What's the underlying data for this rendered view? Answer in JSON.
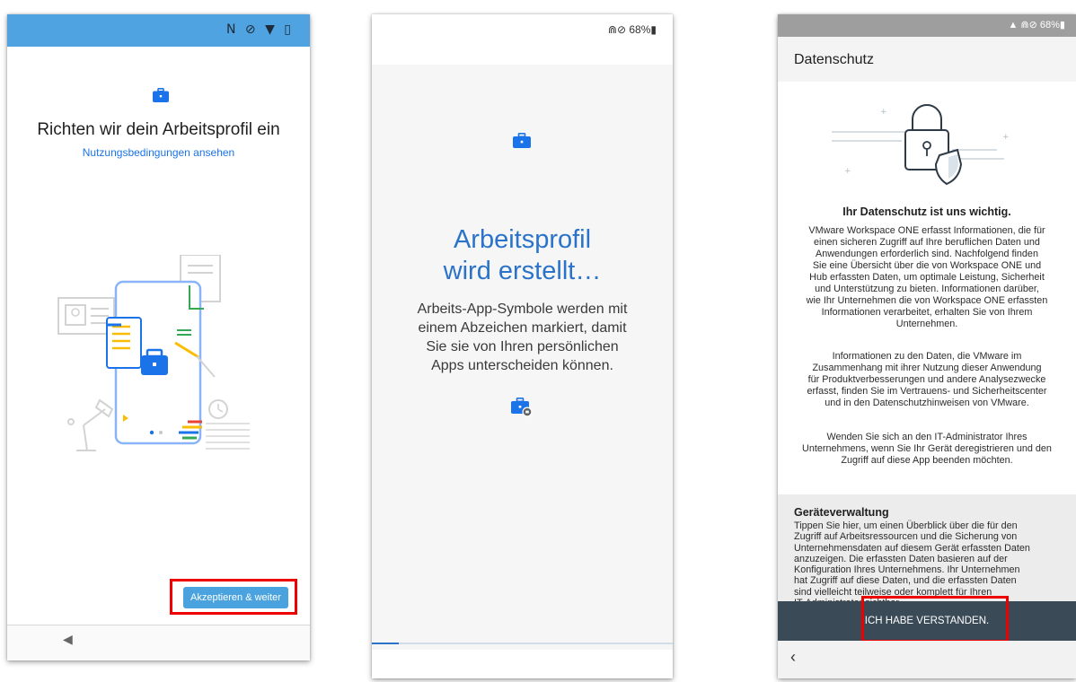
{
  "phone1": {
    "status_icons": "N ⊘ ▼ ▯",
    "title": "Richten wir dein Arbeitsprofil ein",
    "terms_link": "Nutzungsbedingungen ansehen",
    "accept_button": "Akzeptieren & weiter",
    "nav_back_icon": "◀"
  },
  "phone2": {
    "status_text": "⋒⊘ 68%▮",
    "title_lines": [
      "Arbeitsprofil",
      "wird erstellt…"
    ],
    "description_lines": [
      "Arbeits-App-Symbole werden mit",
      "einem Abzeichen markiert, damit",
      "Sie sie von Ihren persönlichen",
      "Apps unterscheiden können."
    ],
    "progress": 0.09
  },
  "phone3": {
    "status_text": "▲ ⋒⊘ 68%▮",
    "header_title": "Datenschutz",
    "privacy_heading": "Ihr Datenschutz ist uns wichtig.",
    "paragraph1": [
      "VMware Workspace ONE erfasst Informationen, die für",
      "einen sicheren Zugriff auf Ihre beruflichen Daten und",
      "Anwendungen erforderlich sind. Nachfolgend finden",
      "Sie eine Übersicht über die von Workspace ONE und",
      "Hub erfassten Daten, um optimale Leistung, Sicherheit",
      "und Unterstützung zu bieten. Informationen darüber,",
      "wie Ihr Unternehmen die von Workspace ONE erfassten",
      "Informationen verarbeitet, erhalten Sie von Ihrem",
      "Unternehmen."
    ],
    "paragraph2": [
      "Informationen zu den Daten, die VMware im",
      "Zusammenhang mit ihrer Nutzung dieser Anwendung",
      "für Produktverbesserungen und andere Analysezwecke",
      "erfasst, finden Sie im Vertrauens- und Sicherheitscenter",
      "und in den Datenschutzhinweisen von VMware."
    ],
    "paragraph3": [
      "Wenden Sie sich an den IT-Administrator Ihres",
      "Unternehmens, wenn Sie Ihr Gerät deregistrieren und den",
      "Zugriff auf diese App beenden möchten."
    ],
    "section_title": "Geräteverwaltung",
    "section_text": [
      "Tippen Sie hier, um einen Überblick über die für den",
      "Zugriff auf Arbeitsressourcen und die Sicherung von",
      "Unternehmensdaten auf diesem Gerät erfassten Daten",
      "anzuzeigen. Die erfassten Daten basieren auf der",
      "Konfiguration Ihres Unternehmens. Ihr Unternehmen",
      "hat Zugriff auf diese Daten, und die erfassten Daten",
      "sind vielleicht teilweise oder komplett für Ihren",
      "IT-Administrator sichtbar."
    ],
    "confirm_button": "ICH HABE VERSTANDEN.",
    "nav_back_icon": "‹"
  },
  "colors": {
    "accent_blue": "#1a73e8",
    "button_blue": "#4aa3df",
    "title_blue": "#2a73c9",
    "dark_button": "#3b4a57",
    "highlight_red": "#ef0000"
  }
}
